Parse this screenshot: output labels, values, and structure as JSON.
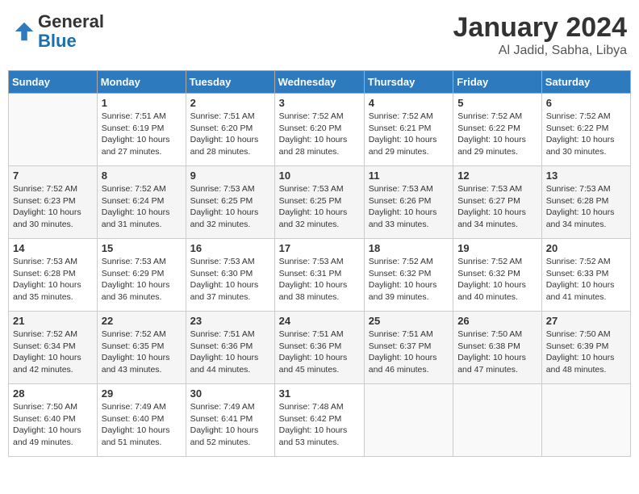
{
  "header": {
    "logo_text_general": "General",
    "logo_text_blue": "Blue",
    "month": "January 2024",
    "location": "Al Jadid, Sabha, Libya"
  },
  "days_of_week": [
    "Sunday",
    "Monday",
    "Tuesday",
    "Wednesday",
    "Thursday",
    "Friday",
    "Saturday"
  ],
  "weeks": [
    [
      {
        "day": "",
        "info": ""
      },
      {
        "day": "1",
        "info": "Sunrise: 7:51 AM\nSunset: 6:19 PM\nDaylight: 10 hours\nand 27 minutes."
      },
      {
        "day": "2",
        "info": "Sunrise: 7:51 AM\nSunset: 6:20 PM\nDaylight: 10 hours\nand 28 minutes."
      },
      {
        "day": "3",
        "info": "Sunrise: 7:52 AM\nSunset: 6:20 PM\nDaylight: 10 hours\nand 28 minutes."
      },
      {
        "day": "4",
        "info": "Sunrise: 7:52 AM\nSunset: 6:21 PM\nDaylight: 10 hours\nand 29 minutes."
      },
      {
        "day": "5",
        "info": "Sunrise: 7:52 AM\nSunset: 6:22 PM\nDaylight: 10 hours\nand 29 minutes."
      },
      {
        "day": "6",
        "info": "Sunrise: 7:52 AM\nSunset: 6:22 PM\nDaylight: 10 hours\nand 30 minutes."
      }
    ],
    [
      {
        "day": "7",
        "info": "Sunrise: 7:52 AM\nSunset: 6:23 PM\nDaylight: 10 hours\nand 30 minutes."
      },
      {
        "day": "8",
        "info": "Sunrise: 7:52 AM\nSunset: 6:24 PM\nDaylight: 10 hours\nand 31 minutes."
      },
      {
        "day": "9",
        "info": "Sunrise: 7:53 AM\nSunset: 6:25 PM\nDaylight: 10 hours\nand 32 minutes."
      },
      {
        "day": "10",
        "info": "Sunrise: 7:53 AM\nSunset: 6:25 PM\nDaylight: 10 hours\nand 32 minutes."
      },
      {
        "day": "11",
        "info": "Sunrise: 7:53 AM\nSunset: 6:26 PM\nDaylight: 10 hours\nand 33 minutes."
      },
      {
        "day": "12",
        "info": "Sunrise: 7:53 AM\nSunset: 6:27 PM\nDaylight: 10 hours\nand 34 minutes."
      },
      {
        "day": "13",
        "info": "Sunrise: 7:53 AM\nSunset: 6:28 PM\nDaylight: 10 hours\nand 34 minutes."
      }
    ],
    [
      {
        "day": "14",
        "info": "Sunrise: 7:53 AM\nSunset: 6:28 PM\nDaylight: 10 hours\nand 35 minutes."
      },
      {
        "day": "15",
        "info": "Sunrise: 7:53 AM\nSunset: 6:29 PM\nDaylight: 10 hours\nand 36 minutes."
      },
      {
        "day": "16",
        "info": "Sunrise: 7:53 AM\nSunset: 6:30 PM\nDaylight: 10 hours\nand 37 minutes."
      },
      {
        "day": "17",
        "info": "Sunrise: 7:53 AM\nSunset: 6:31 PM\nDaylight: 10 hours\nand 38 minutes."
      },
      {
        "day": "18",
        "info": "Sunrise: 7:52 AM\nSunset: 6:32 PM\nDaylight: 10 hours\nand 39 minutes."
      },
      {
        "day": "19",
        "info": "Sunrise: 7:52 AM\nSunset: 6:32 PM\nDaylight: 10 hours\nand 40 minutes."
      },
      {
        "day": "20",
        "info": "Sunrise: 7:52 AM\nSunset: 6:33 PM\nDaylight: 10 hours\nand 41 minutes."
      }
    ],
    [
      {
        "day": "21",
        "info": "Sunrise: 7:52 AM\nSunset: 6:34 PM\nDaylight: 10 hours\nand 42 minutes."
      },
      {
        "day": "22",
        "info": "Sunrise: 7:52 AM\nSunset: 6:35 PM\nDaylight: 10 hours\nand 43 minutes."
      },
      {
        "day": "23",
        "info": "Sunrise: 7:51 AM\nSunset: 6:36 PM\nDaylight: 10 hours\nand 44 minutes."
      },
      {
        "day": "24",
        "info": "Sunrise: 7:51 AM\nSunset: 6:36 PM\nDaylight: 10 hours\nand 45 minutes."
      },
      {
        "day": "25",
        "info": "Sunrise: 7:51 AM\nSunset: 6:37 PM\nDaylight: 10 hours\nand 46 minutes."
      },
      {
        "day": "26",
        "info": "Sunrise: 7:50 AM\nSunset: 6:38 PM\nDaylight: 10 hours\nand 47 minutes."
      },
      {
        "day": "27",
        "info": "Sunrise: 7:50 AM\nSunset: 6:39 PM\nDaylight: 10 hours\nand 48 minutes."
      }
    ],
    [
      {
        "day": "28",
        "info": "Sunrise: 7:50 AM\nSunset: 6:40 PM\nDaylight: 10 hours\nand 49 minutes."
      },
      {
        "day": "29",
        "info": "Sunrise: 7:49 AM\nSunset: 6:40 PM\nDaylight: 10 hours\nand 51 minutes."
      },
      {
        "day": "30",
        "info": "Sunrise: 7:49 AM\nSunset: 6:41 PM\nDaylight: 10 hours\nand 52 minutes."
      },
      {
        "day": "31",
        "info": "Sunrise: 7:48 AM\nSunset: 6:42 PM\nDaylight: 10 hours\nand 53 minutes."
      },
      {
        "day": "",
        "info": ""
      },
      {
        "day": "",
        "info": ""
      },
      {
        "day": "",
        "info": ""
      }
    ]
  ]
}
